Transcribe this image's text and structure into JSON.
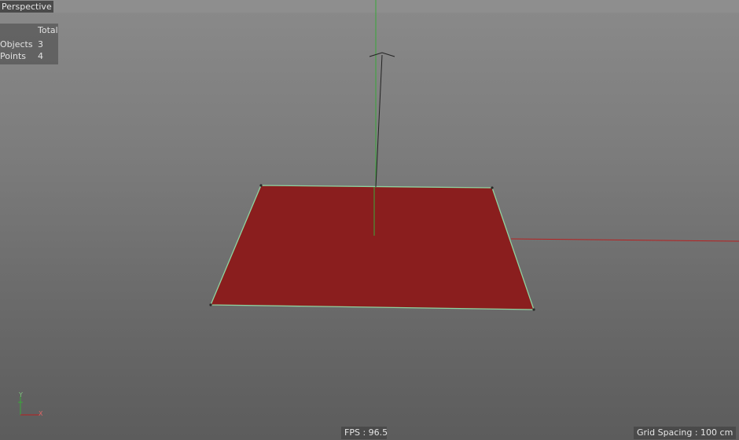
{
  "viewport": {
    "label": "Perspective",
    "fps_text": "FPS : 96.5",
    "grid_spacing_text": "Grid Spacing : 100 cm"
  },
  "stats": {
    "header": "Total",
    "rows": [
      {
        "label": "Objects",
        "value": "3"
      },
      {
        "label": "Points",
        "value": "4"
      }
    ]
  },
  "axis_gizmo": {
    "y_label": "Y",
    "x_label": "X"
  },
  "colors": {
    "plane_fill": "#8a1e1e",
    "plane_edge": "#8fd3a0",
    "y_axis": "#3aa83a",
    "x_axis": "#b82020",
    "z_handle": "#222222"
  }
}
